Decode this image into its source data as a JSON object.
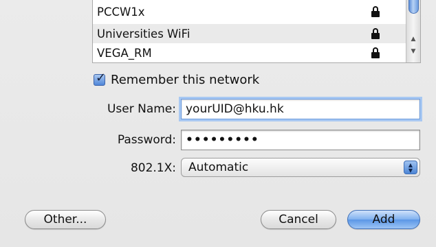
{
  "networks": [
    {
      "name": "PCCW1x",
      "locked": true
    },
    {
      "name": "Universities WiFi",
      "locked": true
    },
    {
      "name": "VEGA_RM",
      "locked": true
    }
  ],
  "remember": {
    "label": "Remember this network",
    "checked": true
  },
  "form": {
    "username_label": "User Name:",
    "username_value": "yourUID@hku.hk",
    "password_label": "Password:",
    "password_value": "•••••••••",
    "security_label": "802.1X:",
    "security_value": "Automatic"
  },
  "buttons": {
    "other": "Other...",
    "cancel": "Cancel",
    "add": "Add"
  },
  "colors": {
    "accent": "#6a9be0",
    "selected_row": "#eaeaea"
  }
}
